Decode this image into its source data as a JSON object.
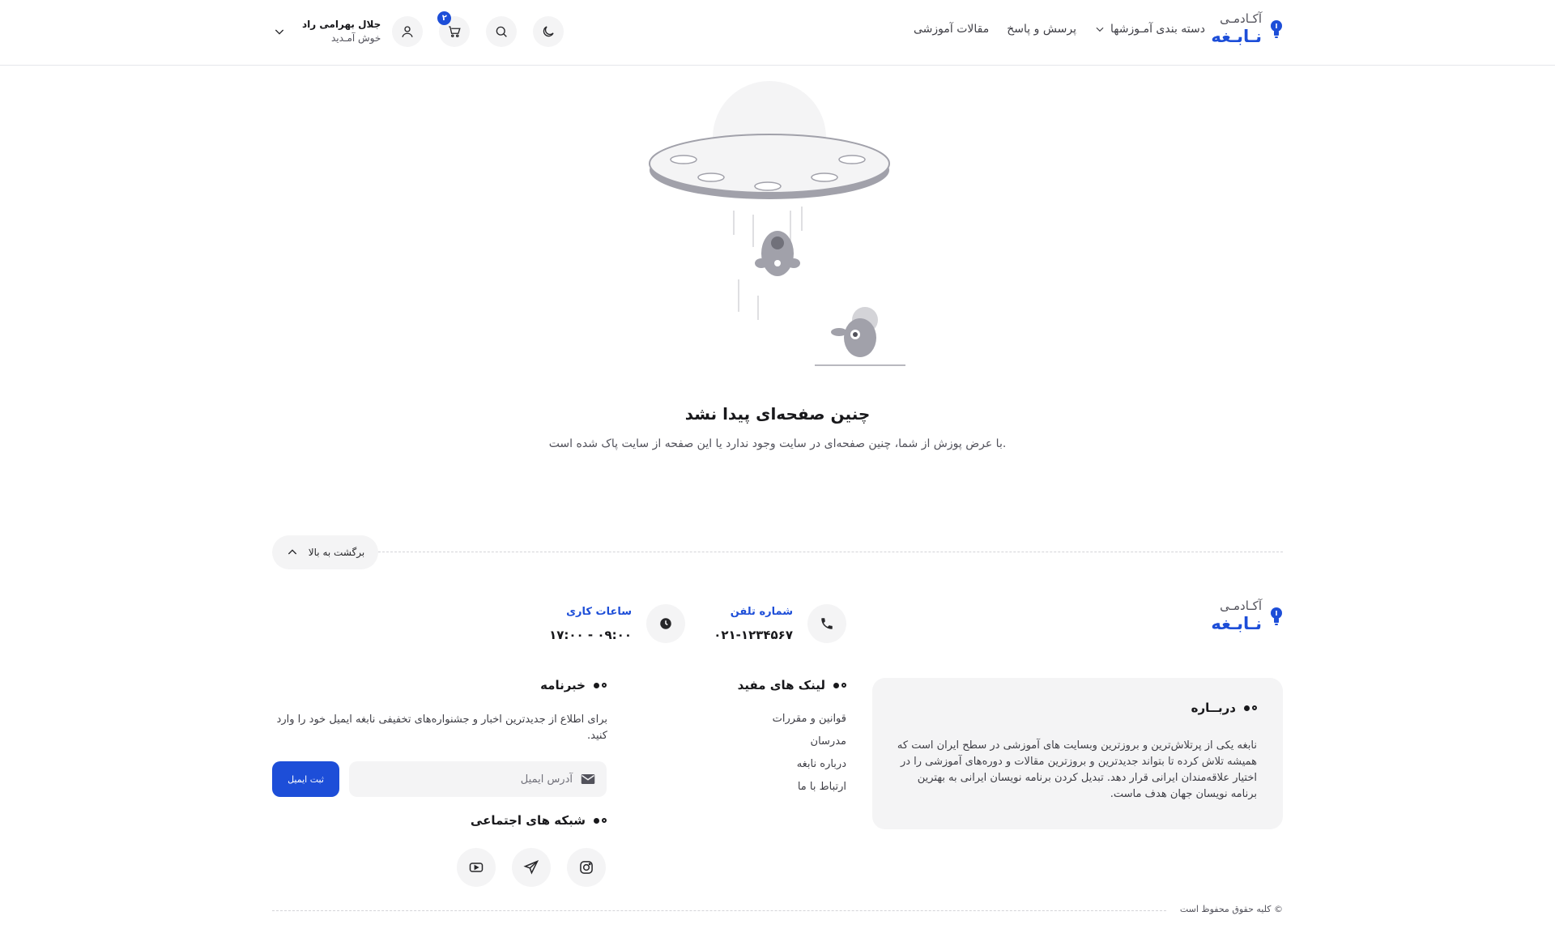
{
  "brand": {
    "line1": "آکـادمـی",
    "line2": "نـابـغه",
    "accent": "#1d4ed8"
  },
  "nav": {
    "categories": "دسته بندی آمـوزشها",
    "qa": "پرسش و پاسخ",
    "articles": "مقالات آموزشی"
  },
  "header": {
    "cart_count": "۲",
    "user_name": "جلال بهرامی راد",
    "welcome": "خوش آمـدید",
    "icons": [
      "moon-icon",
      "search-icon",
      "cart-icon",
      "user-icon",
      "chevron-down-icon"
    ]
  },
  "notfound": {
    "title": "چنین صفحه‌ای پیدا نشد",
    "description": "با عرض پوزش از شما، چنین صفحه‌ای در سایت وجود ندارد یا این صفحه از سایت پاک شده است."
  },
  "back_to_top": "برگشت به بالا",
  "contact": {
    "phone_label": "شماره تلفن",
    "phone_value": "۰۲۱-۱۲۳۴۵۶۷",
    "hours_label": "ساعات کاری",
    "hours_value": "۰۹:۰۰ - ۱۷:۰۰"
  },
  "about": {
    "title": "دربــاره",
    "text": "نابغه یکی از پرتلاش‌ترین و بروزترین وبسایت های آموزشی در سطح ایران است که همیشه تلاش کرده تا بتواند جدیدترین و بروزترین مقالات و دوره‌های آموزشی را در اختیار علاقه‌مندان ایرانی قرار دهد. تبدیل کردن برنامه نویسان ایرانی به بهترین برنامه نویسان جهان هدف ماست."
  },
  "links": {
    "title": "لینک های مفید",
    "items": [
      "قوانین و مقررات",
      "مدرسان",
      "درباره نابغه",
      "ارتباط با ما"
    ]
  },
  "newsletter": {
    "title": "خبرنامه",
    "text": "برای اطلاع از جدیدترین اخبار و جشنواره‌های تخفیفی نابغه ایمیل خود را وارد کنید.",
    "placeholder": "آدرس ایمیل",
    "submit": "ثبت ایمیل"
  },
  "social": {
    "title": "شبکه های اجتماعی",
    "icons": [
      "instagram-icon",
      "telegram-icon",
      "youtube-icon"
    ]
  },
  "copyright": "© کلیه حقوق محفوظ است"
}
